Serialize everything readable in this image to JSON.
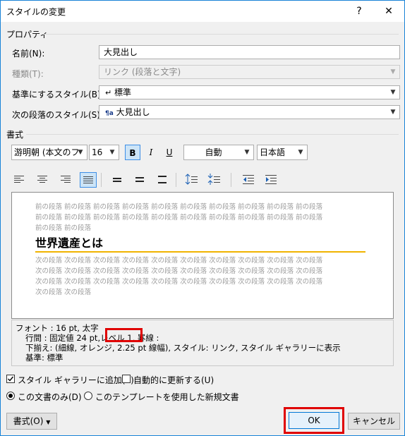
{
  "window": {
    "title": "スタイルの変更",
    "help_glyph": "?",
    "close_glyph": "✕"
  },
  "properties": {
    "group_label": "プロパティ",
    "name_label": "名前(N):",
    "name_value": "大見出し",
    "type_label": "種類(T):",
    "type_value": "リンク (段落と文字)",
    "base_label": "基準にするスタイル(B):",
    "base_value": "標準",
    "next_label": "次の段落のスタイル(S):",
    "next_value": "大見出し"
  },
  "formatting": {
    "group_label": "書式",
    "font_name": "游明朝 (本文のフ",
    "font_size": "16",
    "bold": "B",
    "italic": "I",
    "underline": "U",
    "color_value": "自動",
    "language": "日本語"
  },
  "preview": {
    "before_lines": [
      "前の段落 前の段落 前の段落 前の段落 前の段落 前の段落 前の段落 前の段落 前の段落 前の段落",
      "前の段落 前の段落 前の段落 前の段落 前の段落 前の段落 前の段落 前の段落 前の段落 前の段落",
      "前の段落 前の段落"
    ],
    "heading": "世界遺産とは",
    "after_lines": [
      "次の段落 次の段落 次の段落 次の段落 次の段落 次の段落 次の段落 次の段落 次の段落 次の段落",
      "次の段落 次の段落 次の段落 次の段落 次の段落 次の段落 次の段落 次の段落 次の段落 次の段落",
      "次の段落 次の段落 次の段落 次の段落 次の段落 次の段落 次の段落 次の段落 次の段落 次の段落",
      "次の段落 次の段落"
    ]
  },
  "description": {
    "line1": "フォント : 16 pt, 太字",
    "line2_a": "行間 : 固定値 24 pt,",
    "line2_highlight": "レベル 1",
    "line2_b": ", 罫線 :",
    "line3": "下揃え: (細線, オレンジ,  2.25 pt 線幅), スタイル: リンク, スタイル ギャラリーに表示",
    "line4": "基準: 標準"
  },
  "options": {
    "add_gallery": "スタイル ギャラリーに追加(S)",
    "auto_update": "自動的に更新する(U)",
    "this_doc": "この文書のみ(D)",
    "template": "このテンプレートを使用した新規文書"
  },
  "buttons": {
    "format": "書式(O)",
    "ok": "OK",
    "cancel": "キャンセル"
  },
  "colors": {
    "accent": "#0078d7",
    "highlight_red": "#e00000",
    "underline_orange": "#f0b400"
  }
}
